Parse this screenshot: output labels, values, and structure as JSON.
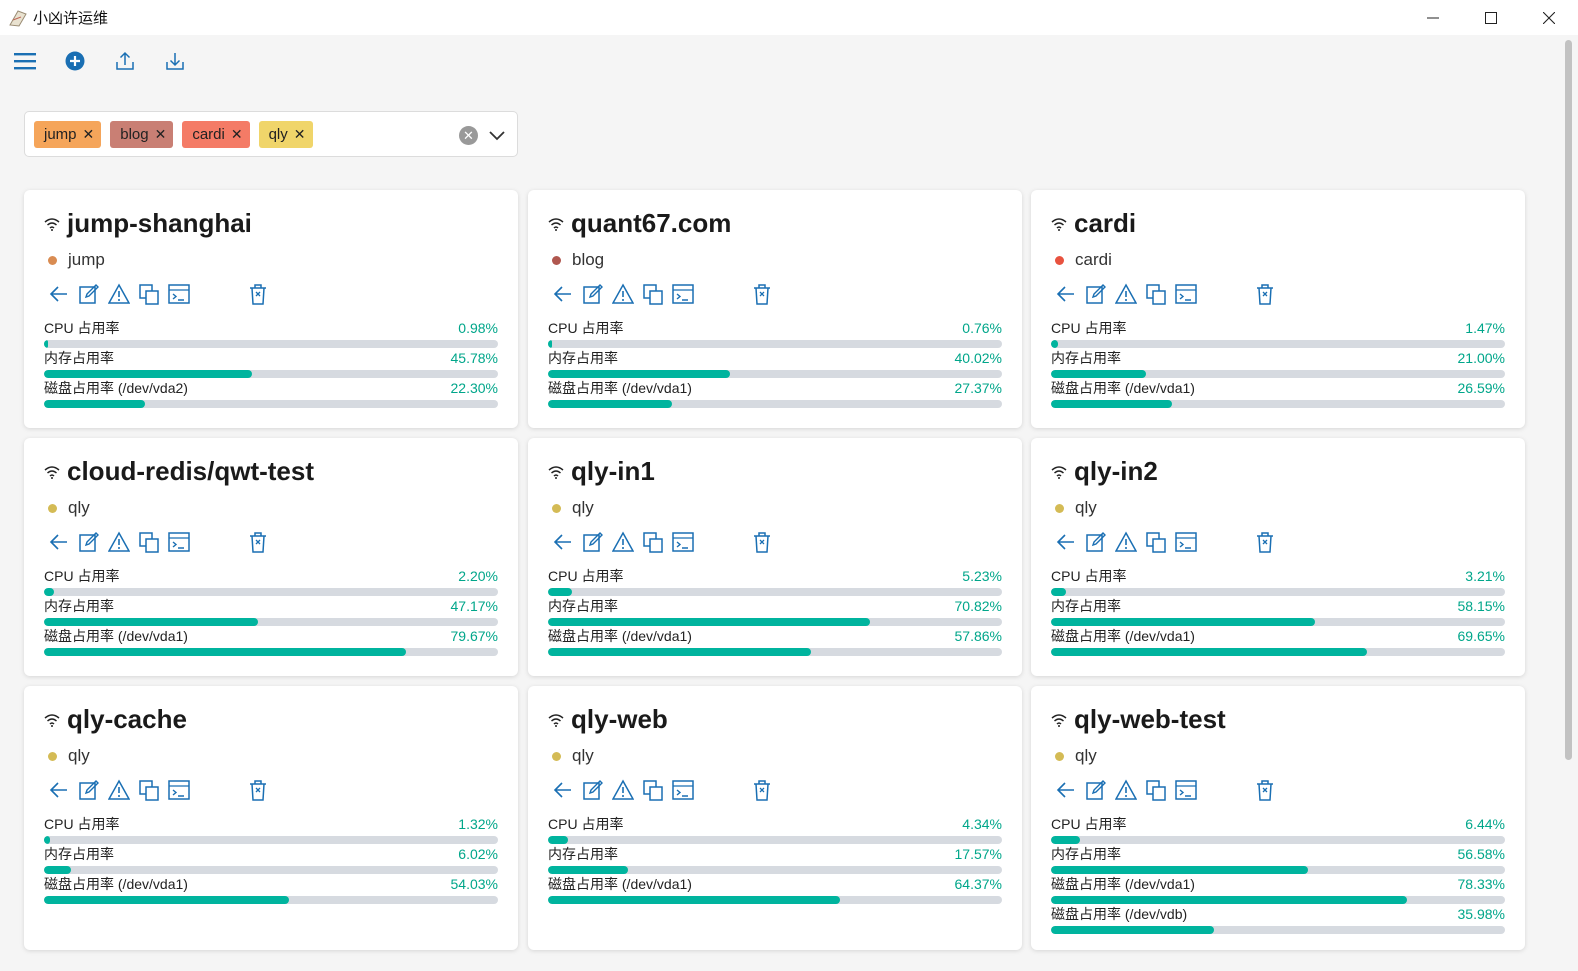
{
  "window": {
    "title": "小凶许运维"
  },
  "toolbar": {
    "icons": [
      "menu-icon",
      "add-circle-icon",
      "upload-icon",
      "download-icon"
    ]
  },
  "filter": {
    "chips": [
      {
        "label": "jump",
        "color": "#f5a55a"
      },
      {
        "label": "blog",
        "color": "#c97f74"
      },
      {
        "label": "cardi",
        "color": "#f47b66"
      },
      {
        "label": "qly",
        "color": "#f0d56a"
      }
    ],
    "remove_glyph": "✕",
    "clear_glyph": "✕"
  },
  "accent": {
    "progress": "#00b49e",
    "value_text": "#00a68a",
    "icon": "#1a6fb3"
  },
  "servers": [
    {
      "name": "jump-shanghai",
      "group": "jump",
      "group_color": "#d98c52",
      "metrics": [
        {
          "label": "CPU 占用率",
          "value": "0.98%",
          "percent": 0.98
        },
        {
          "label": "内存占用率",
          "value": "45.78%",
          "percent": 45.78
        },
        {
          "label": "磁盘占用率 (/dev/vda2)",
          "value": "22.30%",
          "percent": 22.3
        }
      ]
    },
    {
      "name": "quant67.com",
      "group": "blog",
      "group_color": "#b0574f",
      "metrics": [
        {
          "label": "CPU 占用率",
          "value": "0.76%",
          "percent": 0.76
        },
        {
          "label": "内存占用率",
          "value": "40.02%",
          "percent": 40.02
        },
        {
          "label": "磁盘占用率 (/dev/vda1)",
          "value": "27.37%",
          "percent": 27.37
        }
      ]
    },
    {
      "name": "cardi",
      "group": "cardi",
      "group_color": "#e8523f",
      "metrics": [
        {
          "label": "CPU 占用率",
          "value": "1.47%",
          "percent": 1.47
        },
        {
          "label": "内存占用率",
          "value": "21.00%",
          "percent": 21.0
        },
        {
          "label": "磁盘占用率 (/dev/vda1)",
          "value": "26.59%",
          "percent": 26.59
        }
      ]
    },
    {
      "name": "cloud-redis/qwt-test",
      "group": "qly",
      "group_color": "#d4bb55",
      "metrics": [
        {
          "label": "CPU 占用率",
          "value": "2.20%",
          "percent": 2.2
        },
        {
          "label": "内存占用率",
          "value": "47.17%",
          "percent": 47.17
        },
        {
          "label": "磁盘占用率 (/dev/vda1)",
          "value": "79.67%",
          "percent": 79.67
        }
      ]
    },
    {
      "name": "qly-in1",
      "group": "qly",
      "group_color": "#d4bb55",
      "metrics": [
        {
          "label": "CPU 占用率",
          "value": "5.23%",
          "percent": 5.23
        },
        {
          "label": "内存占用率",
          "value": "70.82%",
          "percent": 70.82
        },
        {
          "label": "磁盘占用率 (/dev/vda1)",
          "value": "57.86%",
          "percent": 57.86
        }
      ]
    },
    {
      "name": "qly-in2",
      "group": "qly",
      "group_color": "#d4bb55",
      "metrics": [
        {
          "label": "CPU 占用率",
          "value": "3.21%",
          "percent": 3.21
        },
        {
          "label": "内存占用率",
          "value": "58.15%",
          "percent": 58.15
        },
        {
          "label": "磁盘占用率 (/dev/vda1)",
          "value": "69.65%",
          "percent": 69.65
        }
      ]
    },
    {
      "name": "qly-cache",
      "group": "qly",
      "group_color": "#d4bb55",
      "metrics": [
        {
          "label": "CPU 占用率",
          "value": "1.32%",
          "percent": 1.32
        },
        {
          "label": "内存占用率",
          "value": "6.02%",
          "percent": 6.02
        },
        {
          "label": "磁盘占用率 (/dev/vda1)",
          "value": "54.03%",
          "percent": 54.03
        }
      ]
    },
    {
      "name": "qly-web",
      "group": "qly",
      "group_color": "#d4bb55",
      "metrics": [
        {
          "label": "CPU 占用率",
          "value": "4.34%",
          "percent": 4.34
        },
        {
          "label": "内存占用率",
          "value": "17.57%",
          "percent": 17.57
        },
        {
          "label": "磁盘占用率 (/dev/vda1)",
          "value": "64.37%",
          "percent": 64.37
        }
      ]
    },
    {
      "name": "qly-web-test",
      "group": "qly",
      "group_color": "#d4bb55",
      "metrics": [
        {
          "label": "CPU 占用率",
          "value": "6.44%",
          "percent": 6.44
        },
        {
          "label": "内存占用率",
          "value": "56.58%",
          "percent": 56.58
        },
        {
          "label": "磁盘占用率 (/dev/vda1)",
          "value": "78.33%",
          "percent": 78.33
        },
        {
          "label": "磁盘占用率 (/dev/vdb)",
          "value": "35.98%",
          "percent": 35.98
        }
      ]
    }
  ]
}
